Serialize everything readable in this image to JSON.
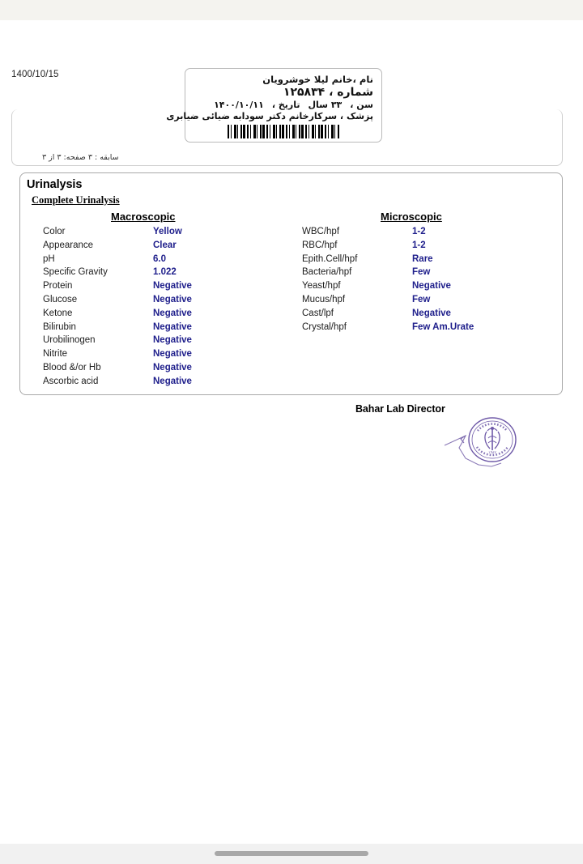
{
  "document": {
    "report_date": "1400/10/15",
    "history_line": "سابقه : ۳    صفحه: ۳  از  ۳"
  },
  "patient_header": {
    "name_line": "نام ،خانم لیلا خوشرویان",
    "number_label": "شماره ،",
    "number_value": "۱۲۵۸۳۴",
    "age_label": "سن ،",
    "age_value": "۳۳ سال",
    "date_label": "تاریخ ،",
    "date_value": "۱۴۰۰/۱۰/۱۱",
    "doctor_line": "پزشک ، سرکارخانم  دکتر سودابه ضیائی ضیابری",
    "barcode_name": "patient-barcode"
  },
  "panel": {
    "title": "Urinalysis",
    "subtitle": "Complete Urinalysis",
    "macroscopic_heading": "Macroscopic",
    "microscopic_heading": "Microscopic",
    "macroscopic": [
      {
        "label": "Color",
        "value": "Yellow"
      },
      {
        "label": "Appearance",
        "value": "Clear"
      },
      {
        "label": "pH",
        "value": "6.0"
      },
      {
        "label": "Specific Gravity",
        "value": "1.022"
      },
      {
        "label": "Protein",
        "value": "Negative"
      },
      {
        "label": "Glucose",
        "value": "Negative"
      },
      {
        "label": "Ketone",
        "value": "Negative"
      },
      {
        "label": "Bilirubin",
        "value": "Negative"
      },
      {
        "label": "Urobilinogen",
        "value": "Negative"
      },
      {
        "label": "Nitrite",
        "value": "Negative"
      },
      {
        "label": "Blood &/or Hb",
        "value": "Negative"
      },
      {
        "label": "Ascorbic acid",
        "value": "Negative"
      }
    ],
    "microscopic": [
      {
        "label": "WBC/hpf",
        "value": "1-2"
      },
      {
        "label": "RBC/hpf",
        "value": "1-2"
      },
      {
        "label": "Epith.Cell/hpf",
        "value": "Rare"
      },
      {
        "label": "Bacteria/hpf",
        "value": "Few"
      },
      {
        "label": "Yeast/hpf",
        "value": "Negative"
      },
      {
        "label": "Mucus/hpf",
        "value": "Few"
      },
      {
        "label": "Cast/lpf",
        "value": "Negative"
      },
      {
        "label": "Crystal/hpf",
        "value": "Few Am.Urate"
      }
    ]
  },
  "signature": {
    "title": "Bahar Lab Director",
    "stamp_name": "lab-official-stamp",
    "stamp_color": "#6f5aa8",
    "stamp_year": "۱۹۸۲"
  },
  "colors": {
    "value_text": "#20208c",
    "label_text": "#1c1c1c",
    "card_border": "#a9a9a9",
    "status_bar": "#f4f3ef",
    "bottom_bar": "#f1f1f1",
    "home_indicator": "#a8a8a8"
  },
  "browser": {
    "home_indicator_name": "home-indicator"
  }
}
